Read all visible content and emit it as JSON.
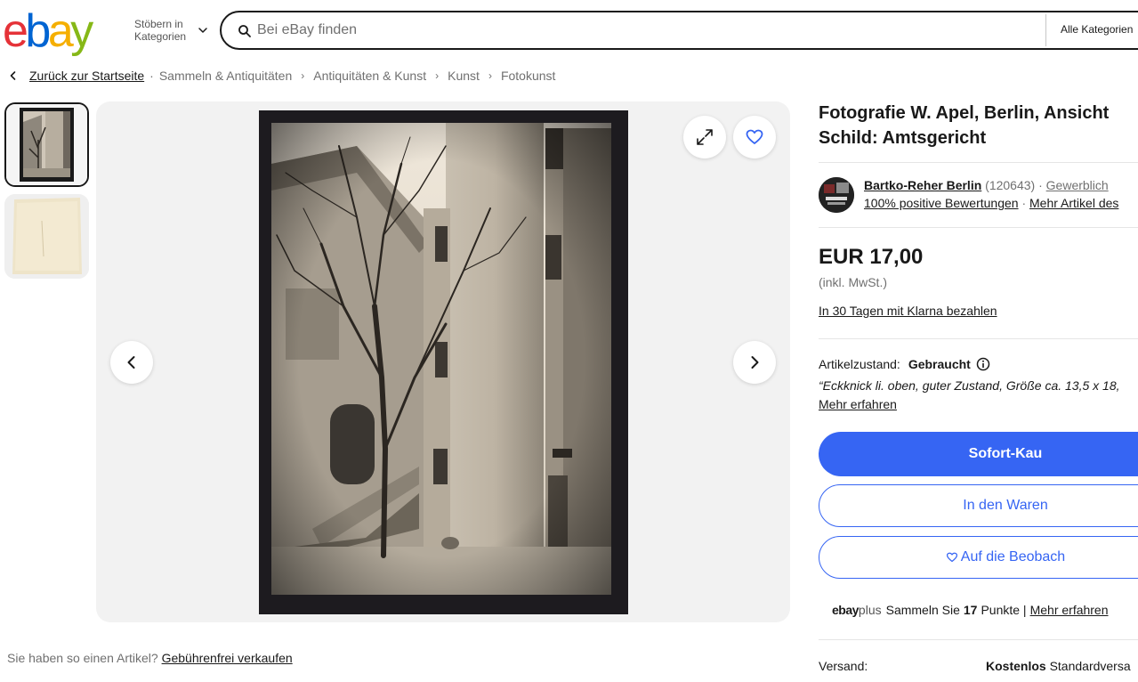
{
  "header": {
    "logo_letters": [
      "e",
      "b",
      "a",
      "y"
    ],
    "logo_colors": [
      "#e53238",
      "#0064d2",
      "#f5af02",
      "#86b817"
    ],
    "browse_line1": "Stöbern in",
    "browse_line2": "Kategorien",
    "search_placeholder": "Bei eBay finden",
    "category_select": "Alle Kategorien"
  },
  "breadcrumb": {
    "back": "Zurück zur Startseite",
    "items": [
      "Sammeln & Antiquitäten",
      "Antiquitäten & Kunst",
      "Kunst",
      "Fotokunst"
    ]
  },
  "gallery": {
    "thumbnails": [
      "photo-front",
      "photo-back"
    ],
    "main_image": "photo-courtyard"
  },
  "sell_prompt": {
    "text": "Sie haben so einen Artikel?",
    "link": "Gebührenfrei verkaufen"
  },
  "listing": {
    "title_line1": "Fotografie W. Apel, Berlin, Ansicht",
    "title_line2": "Schild: Amtsgericht",
    "seller": {
      "name": "Bartko-Reher Berlin",
      "count": "(120643)",
      "type": "Gewerblich",
      "feedback": "100% positive Bewertungen",
      "more_items": "Mehr Artikel des"
    },
    "price": "EUR 17,00",
    "vat": "(inkl. MwSt.)",
    "klarna": "In 30 Tagen mit Klarna bezahlen",
    "condition_label": "Artikelzustand:",
    "condition_value": "Gebraucht",
    "condition_quote": "“Eckknick li. oben, guter Zustand, Größe ca. 13,5 x 18,",
    "condition_more": "Mehr erfahren",
    "buy_button": "Sofort-Kau",
    "cart_button": "In den Waren",
    "watch_button": "Auf die Beobach",
    "plus": {
      "brand_ebay": "ebay",
      "brand_plus": "plus",
      "text_before": "Sammeln Sie",
      "points": "17",
      "text_after": "Punkte |",
      "link": "Mehr erfahren"
    },
    "shipping_label": "Versand:",
    "shipping_free": "Kostenlos",
    "shipping_method": "Standardversa"
  },
  "colors": {
    "accent": "#3665f3",
    "text": "#191919",
    "muted": "#707070"
  }
}
